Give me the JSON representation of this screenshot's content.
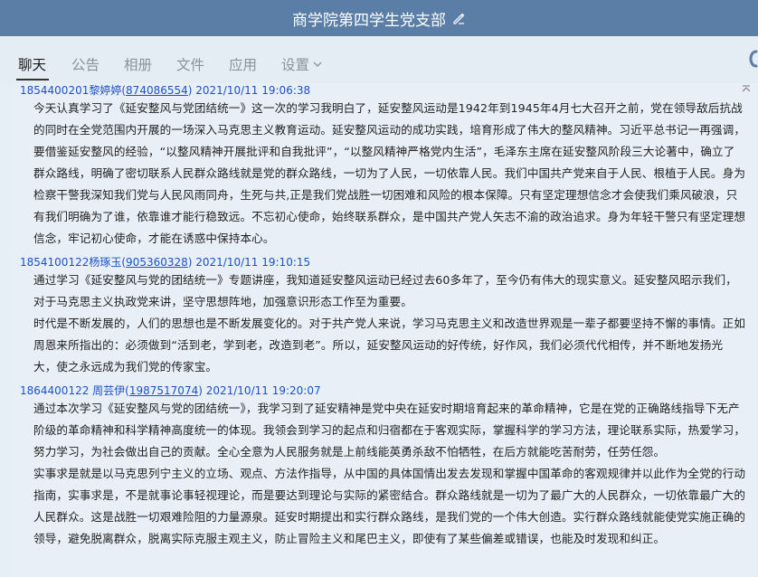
{
  "window": {
    "title": "商学院第四学生党支部",
    "edit_icon": "pencil-icon"
  },
  "tabs": [
    {
      "label": "聊天",
      "active": true
    },
    {
      "label": "公告",
      "active": false
    },
    {
      "label": "相册",
      "active": false
    },
    {
      "label": "文件",
      "active": false
    },
    {
      "label": "应用",
      "active": false
    },
    {
      "label": "设置",
      "active": false
    }
  ],
  "messages": [
    {
      "sender_name": "1854400201黎婷婷",
      "sender_qq": "874086554",
      "timestamp": "2021/10/11 19:06:38",
      "paragraphs": [
        "今天认真学习了《延安整风与党团结统一》这一次的学习我明白了，延安整风运动是1942年到1945年4月七大召开之前，党在领导敌后抗战的同时在全党范围内开展的一场深入马克思主义教育运动。延安整风运动的成功实践，培育形成了伟大的整风精神。习近平总书记一再强调，要借鉴延安整风的经验，“以整风精神开展批评和自我批评”，“以整风精神严格党内生活”，毛泽东主席在延安整风阶段三大论著中，确立了群众路线，明确了密切联系人民群众路线就是党的群众路线，一切为了人民，一切依靠人民。我们中国共产党来自于人民、根植于人民。身为检察干警我深知我们党与人民风雨同舟，生死与共,正是我们党战胜一切困难和风险的根本保障。只有坚定理想信念才会使我们乘风破浪，只有我们明确为了谁，依靠谁才能行稳致远。不忘初心使命，始终联系群众，是中国共产党人矢志不渝的政治追求。身为年轻干警只有坚定理想信念，牢记初心使命，才能在诱惑中保持本心。"
      ]
    },
    {
      "sender_name": "1854100122杨琢玉",
      "sender_qq": "905360328",
      "timestamp": "2021/10/11 19:10:15",
      "paragraphs": [
        "通过学习《延安整风与党的团结统一》专题讲座，我知道延安整风运动已经过去60多年了，至今仍有伟大的现实意义。延安整风昭示我们，对于马克思主义执政党来讲，坚守思想阵地，加强意识形态工作至为重要。",
        "时代是不断发展的，人们的思想也是不断发展变化的。对于共产党人来说，学习马克思主义和改造世界观是一辈子都要坚持不懈的事情。正如周恩来所指出的：必须做到“活到老，学到老，改造到老”。所以，延安整风运动的好传统，好作风，我们必须代代相传，并不断地发扬光大，使之永远成为我们党的传家宝。"
      ]
    },
    {
      "sender_name": "1864400122 周芸伊",
      "sender_qq": "1987517074",
      "timestamp": "2021/10/11 19:20:07",
      "paragraphs": [
        "通过本次学习《延安整风与党的团结统一》，我学习到了延安精神是党中央在延安时期培育起来的革命精神，它是在党的正确路线指导下无产阶级的革命精神和科学精神高度统一的体现。我领会到学习的起点和归宿都在于客观实际，掌握科学的学习方法，理论联系实际，热爱学习，努力学习，为社会做出自己的贡献。全心全意为人民服务就是上前线能英勇杀敌不怕牺牲，在后方就能吃苦耐劳，任劳任怨。",
        "实事求是就是以马克思列宁主义的立场、观点、方法作指导，从中国的具体国情出发去发现和掌握中国革命的客观规律并以此作为全党的行动指南，实事求是，不是就事论事轻视理论，而是要达到理论与实际的紧密结合。群众路线就是一切为了最广大的人民群众，一切依靠最广大的人民群众。这是战胜一切艰难险阻的力量源泉。延安时期提出和实行群众路线，是我们党的一个伟大创造。实行群众路线就能使党实施正确的领导，避免脱离群众，脱离实际克服主观主义，防止冒险主义和尾巴主义，即使有了某些偏差或错误，也能及时发现和纠正。"
      ]
    }
  ],
  "icons": {
    "settings_dropdown": "chevron-down-icon",
    "phone": "phone-icon",
    "scroll_up": "scroll-up-icon"
  },
  "colors": {
    "title_bar": "#5a7ea6",
    "sender_link": "#1a52c9",
    "background": "#e6eef6"
  }
}
